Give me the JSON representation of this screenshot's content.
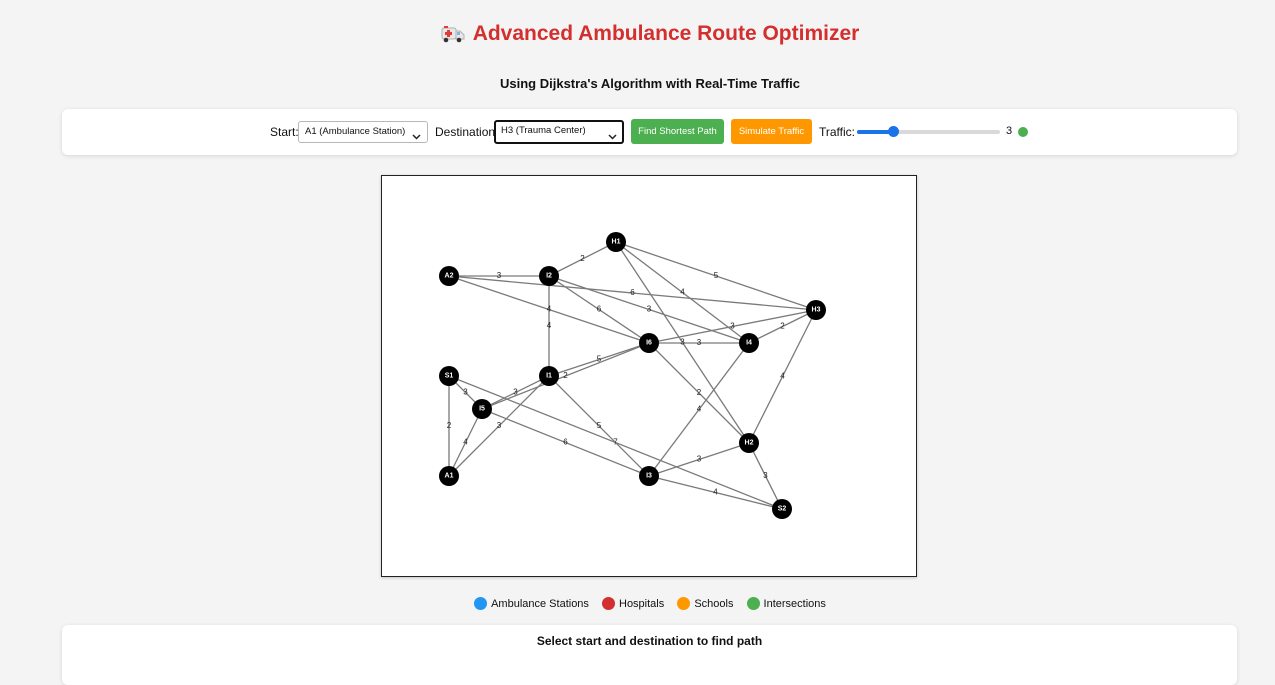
{
  "header": {
    "title": "Advanced Ambulance Route Optimizer",
    "icon": "ambulance-icon",
    "subtitle": "Using Dijkstra's Algorithm with Real-Time Traffic"
  },
  "controls": {
    "start_label": "Start:",
    "start_value": "A1 (Ambulance Station)",
    "destination_label": "Destination:",
    "destination_value": "H3 (Trauma Center)",
    "find_button": "Find Shortest Path",
    "simulate_button": "Simulate Traffic",
    "traffic_label": "Traffic:",
    "traffic_value": "3",
    "traffic_level_fraction": 0.26,
    "traffic_indicator_color": "#4caf50"
  },
  "graph": {
    "nodes": [
      "H1",
      "A2",
      "I2",
      "H3",
      "I6",
      "I4",
      "S1",
      "I1",
      "I5",
      "H2",
      "A1",
      "I3",
      "S2"
    ],
    "edges": [
      {
        "from": "A2",
        "to": "I2",
        "weight": "3"
      },
      {
        "from": "I2",
        "to": "H1",
        "weight": "2"
      },
      {
        "from": "H1",
        "to": "H3",
        "weight": "5"
      },
      {
        "from": "H1",
        "to": "I4",
        "weight": "4"
      },
      {
        "from": "H1",
        "to": "H2",
        "weight": "3"
      },
      {
        "from": "A2",
        "to": "H3",
        "weight": "6"
      },
      {
        "from": "A2",
        "to": "I6",
        "weight": "4"
      },
      {
        "from": "I2",
        "to": "I1",
        "weight": "4"
      },
      {
        "from": "I2",
        "to": "I6",
        "weight": "6"
      },
      {
        "from": "I2",
        "to": "I4",
        "weight": "3"
      },
      {
        "from": "I6",
        "to": "I4",
        "weight": "3"
      },
      {
        "from": "I6",
        "to": "H3",
        "weight": "3"
      },
      {
        "from": "I4",
        "to": "H3",
        "weight": "2"
      },
      {
        "from": "H3",
        "to": "H2",
        "weight": "4"
      },
      {
        "from": "I1",
        "to": "I6",
        "weight": "5"
      },
      {
        "from": "I5",
        "to": "I6",
        "weight": "2"
      },
      {
        "from": "I6",
        "to": "H2",
        "weight": "2"
      },
      {
        "from": "I4",
        "to": "I3",
        "weight": "4"
      },
      {
        "from": "S1",
        "to": "I5",
        "weight": "3"
      },
      {
        "from": "S1",
        "to": "A1",
        "weight": "2"
      },
      {
        "from": "S1",
        "to": "S2",
        "weight": "7"
      },
      {
        "from": "I5",
        "to": "I1",
        "weight": "3"
      },
      {
        "from": "A1",
        "to": "I5",
        "weight": "4"
      },
      {
        "from": "A1",
        "to": "I1",
        "weight": "3"
      },
      {
        "from": "I1",
        "to": "I3",
        "weight": "5"
      },
      {
        "from": "I5",
        "to": "I3",
        "weight": "6"
      },
      {
        "from": "I3",
        "to": "H2",
        "weight": "3"
      },
      {
        "from": "I3",
        "to": "S2",
        "weight": "4"
      },
      {
        "from": "H2",
        "to": "S2",
        "weight": "3"
      }
    ],
    "node_color": "#000000",
    "edge_color": "#7a7a7a"
  },
  "legend": [
    {
      "label": "Ambulance Stations",
      "color": "#2196f3"
    },
    {
      "label": "Hospitals",
      "color": "#d32f2f"
    },
    {
      "label": "Schools",
      "color": "#ff9800"
    },
    {
      "label": "Intersections",
      "color": "#4caf50"
    }
  ],
  "result": {
    "message": "Select start and destination to find path"
  }
}
